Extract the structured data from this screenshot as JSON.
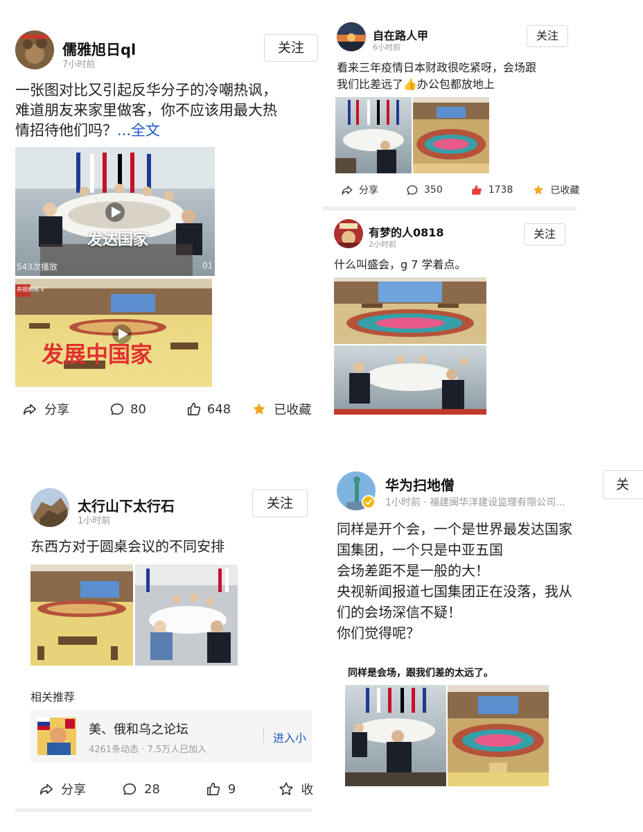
{
  "post1": {
    "username": "儒雅旭日ql",
    "time": "7小时前",
    "follow_label": "关注",
    "text_lines": [
      "一张图对比又引起反华分子的冷嘲热讽，",
      "难道朋友来家里做客，你不应该用最大热",
      "情招待他们吗？"
    ],
    "more_label": "...全文",
    "video_top": {
      "label": "发达国家",
      "play_count": "543次播放",
      "duration": "01"
    },
    "video_bottom": {
      "label": "发展中国家",
      "corner_label": "央视新闻 V"
    },
    "actions": {
      "share": "分享",
      "comments": "80",
      "likes": "648",
      "favorite": "已收藏"
    }
  },
  "post2": {
    "username": "自在路人甲",
    "time": "6小时前",
    "follow_label": "关注",
    "text_lines": [
      "看来三年疫情日本财政很吃紧呀，会场跟",
      "我们比差远了👍办公包都放地上"
    ],
    "actions": {
      "share": "分享",
      "comments": "350",
      "likes": "1738",
      "favorite": "已收藏"
    }
  },
  "post3": {
    "username": "有梦的人0818",
    "time": "2小时前",
    "follow_label": "关注",
    "text_lines": [
      "什么叫盛会，g 7 学着点。"
    ]
  },
  "post4": {
    "username": "太行山下太行石",
    "time": "1小时前",
    "follow_label": "关注",
    "text_lines": [
      "东西方对于圆桌会议的不同安排"
    ],
    "related_title": "相关推荐",
    "related": {
      "name": "美、俄和乌之论坛",
      "stats": "4261条动态 · 7.5万人已加入",
      "enter": "进入小"
    },
    "actions": {
      "share": "分享",
      "comments": "28",
      "likes": "9",
      "favorite": "收"
    }
  },
  "post5": {
    "username": "华为扫地僧",
    "time": "1小时前 · 福建闽华洋建设监理有限公司...",
    "follow_label": "关",
    "text_lines": [
      "同样是开个会，一个是世界最发达国家",
      "国集团，一个只是中亚五国",
      "会场差距不是一般的大！",
      "央视新闻报道七国集团正在没落，我从",
      "们的会场深信不疑！",
      "你们觉得呢？"
    ],
    "image_caption": "同样是会场，跟我们差的太远了。"
  },
  "icons": [
    "share-icon",
    "comment-icon",
    "like-icon",
    "star-icon",
    "play-icon",
    "verified-icon"
  ],
  "colors": {
    "link": "#1a56c9",
    "star": "#f5a623",
    "like_red": "#e8403a",
    "muted": "#999999",
    "divider": "#eeeeee",
    "red_label": "#e03030"
  }
}
